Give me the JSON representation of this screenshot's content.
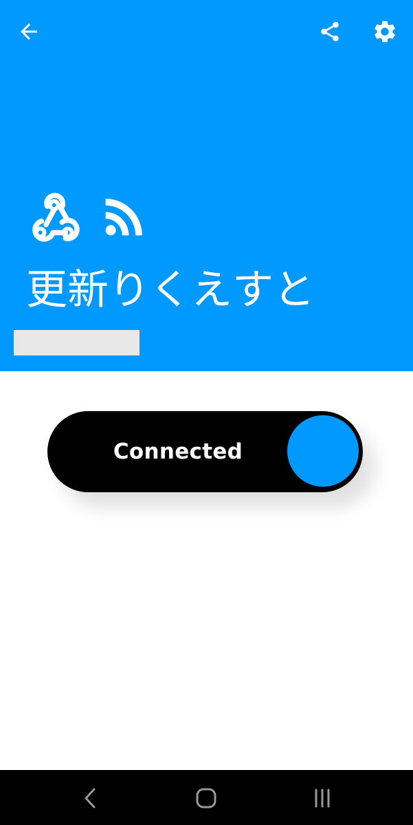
{
  "colors": {
    "header_bg": "#0099ff",
    "toggle_bg": "#000000",
    "knob": "#0099ff",
    "redacted_block": "#e8e8e8",
    "nav_icon": "#9a9a9a"
  },
  "header": {
    "back_icon": "arrow-left-icon",
    "share_icon": "share-icon",
    "settings_icon": "gear-icon",
    "service_icons": [
      "webhooks-icon",
      "rss-feed-icon"
    ],
    "title": "更新りくえすと"
  },
  "toggle": {
    "label": "Connected",
    "on": true
  },
  "navbar": {
    "back_icon": "chevron-left-icon",
    "home_icon": "home-rounded-square-icon",
    "recents_icon": "recents-bars-icon"
  }
}
